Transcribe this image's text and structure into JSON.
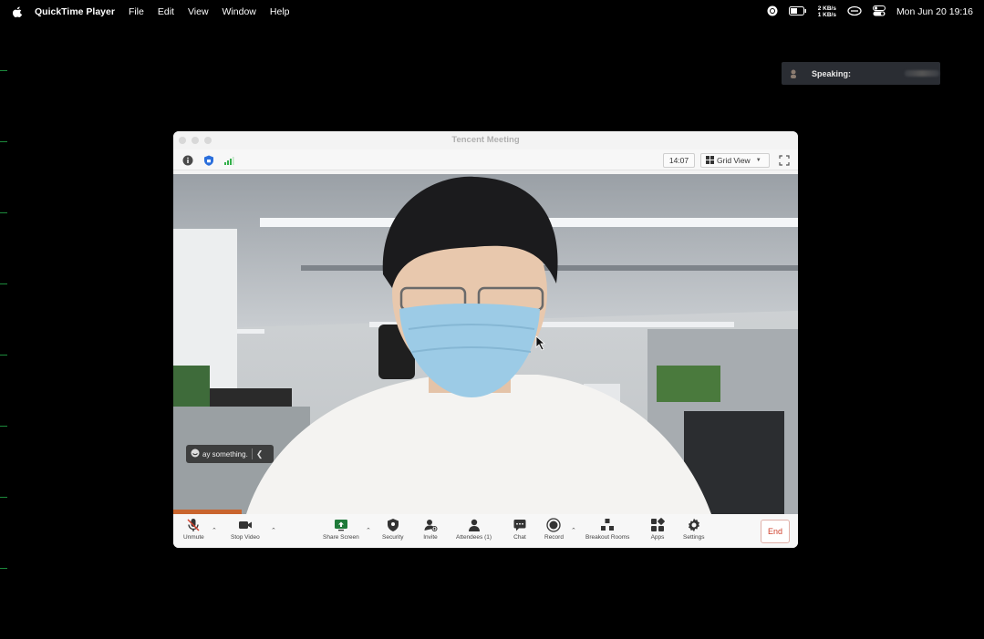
{
  "menubar": {
    "app_name": "QuickTime Player",
    "menus": [
      "File",
      "Edit",
      "View",
      "Window",
      "Help"
    ],
    "net_up": "2 KB/s",
    "net_down": "1 KB/s",
    "clock": "Mon Jun 20  19:16"
  },
  "speaking": {
    "label": "Speaking:"
  },
  "window": {
    "title": "Tencent Meeting",
    "timer": "14:07",
    "view_label": "Grid View"
  },
  "video": {
    "chat_placeholder": "ay something."
  },
  "toolbar": {
    "unmute": "Unmute",
    "stop_video": "Stop Video",
    "share_screen": "Share Screen",
    "security": "Security",
    "invite": "Invite",
    "attendees": "Attendees (1)",
    "chat": "Chat",
    "record": "Record",
    "breakout_rooms": "Breakout Rooms",
    "apps": "Apps",
    "settings": "Settings",
    "end": "End"
  },
  "colors": {
    "end_red": "#d0402c",
    "window_bg": "#f3f3f3",
    "speaking_bg": "#2a2d33"
  }
}
